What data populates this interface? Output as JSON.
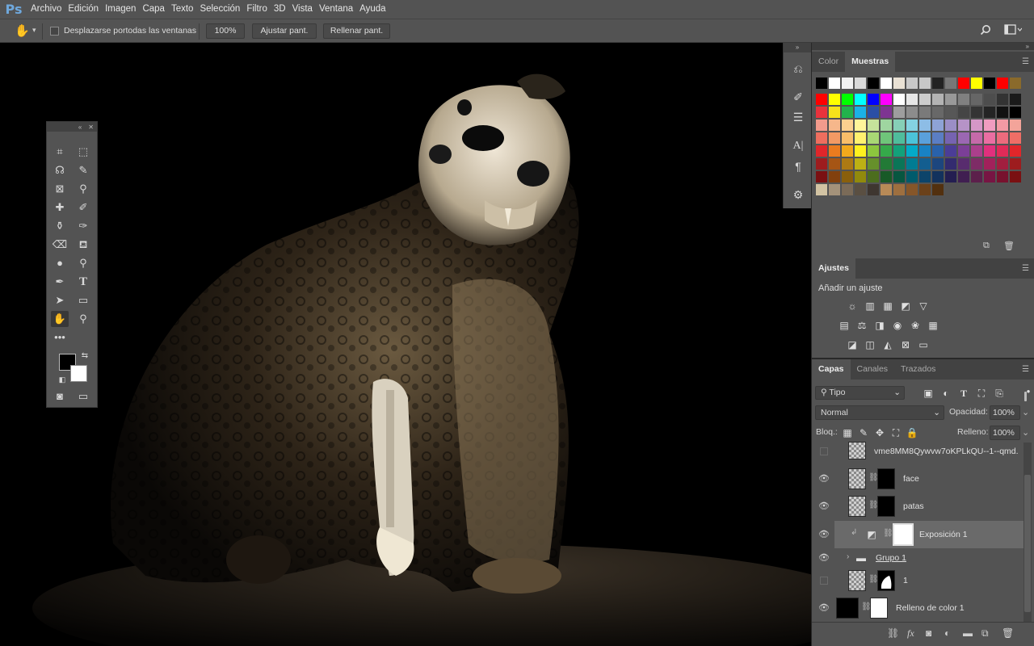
{
  "app": {
    "logo": "Ps"
  },
  "menu": [
    "Archivo",
    "Edición",
    "Imagen",
    "Capa",
    "Texto",
    "Selección",
    "Filtro",
    "3D",
    "Vista",
    "Ventana",
    "Ayuda"
  ],
  "options": {
    "tool_icon": "hand-icon",
    "scroll_all_label": "Desplazarse portodas las ventanas",
    "zoom_button": "100%",
    "fit_button": "Ajustar pant.",
    "fill_button": "Rellenar pant."
  },
  "color_panel": {
    "tabs": [
      "Color",
      "Muestras"
    ],
    "active_tab": "Muestras"
  },
  "adjustments": {
    "tab": "Ajustes",
    "subtitle": "Añadir un ajuste"
  },
  "layers": {
    "tabs": [
      "Capas",
      "Canales",
      "Trazados"
    ],
    "filter_value": "Tipo",
    "blend_mode": "Normal",
    "opacity_label": "Opacidad:",
    "opacity_value": "100%",
    "lock_label": "Bloq.:",
    "fill_label": "Relleno:",
    "fill_value": "100%",
    "items": [
      {
        "name": "vme8MM8Qywvw7oKPLkQU--1--qmd...",
        "visible": false
      },
      {
        "name": "face",
        "visible": true
      },
      {
        "name": "patas",
        "visible": true
      },
      {
        "name": "Exposición 1",
        "visible": true,
        "selected": true
      },
      {
        "name": "Grupo 1",
        "visible": true
      },
      {
        "name": "1",
        "visible": false
      },
      {
        "name": "Relleno de color 1",
        "visible": true
      }
    ]
  },
  "colors": {
    "chrome": "#535353",
    "dark": "#424242",
    "canvas": "#000000"
  }
}
